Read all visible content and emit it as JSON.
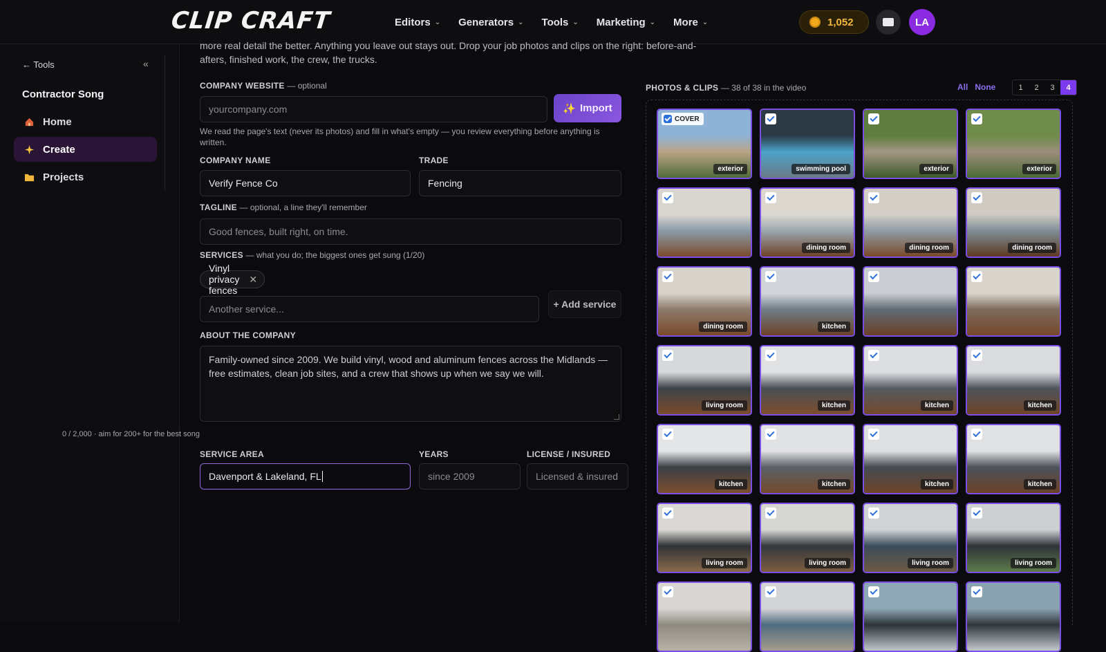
{
  "header": {
    "logo": "CLIP CRAFT",
    "nav": [
      {
        "label": "Editors"
      },
      {
        "label": "Generators"
      },
      {
        "label": "Tools"
      },
      {
        "label": "Marketing"
      },
      {
        "label": "More"
      }
    ],
    "coins": "1,052",
    "avatar_initials": "LA"
  },
  "sidebar": {
    "back_label": "← Tools",
    "collapse_label": "«",
    "title": "Contractor Song",
    "items": [
      {
        "label": "Home",
        "icon": "home-icon"
      },
      {
        "label": "Create",
        "icon": "sparkle-icon"
      },
      {
        "label": "Projects",
        "icon": "folder-icon"
      }
    ]
  },
  "form": {
    "intro": "more real detail the better. Anything you leave out stays out. Drop your job photos and clips on the right: before-and-afters, finished work, the crew, the trucks.",
    "website": {
      "label": "COMPANY WEBSITE",
      "optional": "— optional",
      "placeholder": "yourcompany.com",
      "import_label": "Import",
      "hint": "We read the page's text (never its photos) and fill in what's empty — you review everything before anything is written."
    },
    "company_name": {
      "label": "COMPANY NAME",
      "value": "Verify Fence Co"
    },
    "trade": {
      "label": "TRADE",
      "value": "Fencing"
    },
    "tagline": {
      "label": "TAGLINE",
      "optional": "— optional, a line they'll remember",
      "placeholder": "Good fences, built right, on time."
    },
    "services": {
      "label": "SERVICES",
      "optional": "— what you do; the biggest ones get sung (1/20)",
      "chips": [
        "Vinyl privacy fences"
      ],
      "placeholder": "Another service...",
      "add_label": "+ Add service"
    },
    "about": {
      "label": "ABOUT THE COMPANY",
      "value": "Family-owned since 2009. We build vinyl, wood and aluminum fences across the Midlands — free estimates, clean job sites, and a crew that shows up when we say we will.",
      "count": "0 / 2,000 · aim for 200+ for the best song"
    },
    "service_area": {
      "label": "SERVICE AREA",
      "value": "Davenport & Lakeland, FL"
    },
    "years": {
      "label": "YEARS",
      "placeholder": "since 2009"
    },
    "license": {
      "label": "LICENSE / INSURED",
      "placeholder": "Licensed & insured"
    }
  },
  "photos": {
    "title": "PHOTOS & CLIPS",
    "subtitle": "— 38 of 38 in the video",
    "all_label": "All",
    "none_label": "None",
    "pages": [
      "1",
      "2",
      "3",
      "4"
    ],
    "active_page": "4",
    "cover_label": "COVER",
    "items": [
      {
        "tag": "exterior",
        "cover": true,
        "palette": [
          "#8fb3d6",
          "#b9a486",
          "#4f6b3a"
        ]
      },
      {
        "tag": "swimming pool",
        "palette": [
          "#2c3a46",
          "#4aa3c8",
          "#6a7b86"
        ]
      },
      {
        "tag": "exterior",
        "palette": [
          "#5e7d3f",
          "#a39683",
          "#3d5a2a"
        ]
      },
      {
        "tag": "exterior",
        "palette": [
          "#6f8c4a",
          "#9c8e7c",
          "#4a6b34"
        ]
      },
      {
        "tag": "",
        "palette": [
          "#d9d6cf",
          "#8a9ba9",
          "#7a4b2c"
        ]
      },
      {
        "tag": "dining room",
        "palette": [
          "#dcd8d0",
          "#9aa6ae",
          "#6f4327"
        ]
      },
      {
        "tag": "dining room",
        "palette": [
          "#d3cec6",
          "#8f9ca4",
          "#7a4a2a"
        ]
      },
      {
        "tag": "dining room",
        "palette": [
          "#cfcac2",
          "#7f8d95",
          "#5e3a22"
        ]
      },
      {
        "tag": "dining room",
        "palette": [
          "#d7d2ca",
          "#8c7a6a",
          "#7b4a2b"
        ]
      },
      {
        "tag": "kitchen",
        "palette": [
          "#d2d6da",
          "#6f7c86",
          "#6d4327"
        ]
      },
      {
        "tag": "",
        "palette": [
          "#c9ccd0",
          "#5f6b74",
          "#6a4128"
        ]
      },
      {
        "tag": "",
        "palette": [
          "#d8d4cc",
          "#7c6a5c",
          "#76482a"
        ]
      },
      {
        "tag": "living room",
        "palette": [
          "#d6d9dc",
          "#3d4248",
          "#7a4c2c"
        ]
      },
      {
        "tag": "kitchen",
        "palette": [
          "#dfe1e3",
          "#4a4f55",
          "#7c4e2d"
        ]
      },
      {
        "tag": "kitchen",
        "palette": [
          "#dcdee1",
          "#555b62",
          "#74482a"
        ]
      },
      {
        "tag": "kitchen",
        "palette": [
          "#dadcdf",
          "#4e545b",
          "#6f4428"
        ]
      },
      {
        "tag": "kitchen",
        "palette": [
          "#e4e5e7",
          "#3b4046",
          "#7b4e2e"
        ]
      },
      {
        "tag": "kitchen",
        "palette": [
          "#e1e2e4",
          "#5a6067",
          "#75492b"
        ]
      },
      {
        "tag": "kitchen",
        "palette": [
          "#dedfe1",
          "#444a51",
          "#6e4429"
        ]
      },
      {
        "tag": "kitchen",
        "palette": [
          "#e0e1e3",
          "#4c5259",
          "#6b4228"
        ]
      },
      {
        "tag": "living room",
        "palette": [
          "#d9d8d4",
          "#2e3236",
          "#8a6a4a"
        ]
      },
      {
        "tag": "living room",
        "palette": [
          "#d6d6d3",
          "#34383d",
          "#7d5d40"
        ]
      },
      {
        "tag": "living room",
        "palette": [
          "#cfd3d6",
          "#3a4c5a",
          "#6e5a44"
        ]
      },
      {
        "tag": "living room",
        "palette": [
          "#ccd0d3",
          "#2f3338",
          "#5d7a4a"
        ]
      },
      {
        "tag": "",
        "palette": [
          "#d7d6d2",
          "#8f8a80",
          "#b7b2a6"
        ]
      },
      {
        "tag": "",
        "palette": [
          "#d3d4d6",
          "#4f6c7d",
          "#a59c8e"
        ]
      },
      {
        "tag": "",
        "palette": [
          "#8ea7b6",
          "#2d3338",
          "#bfc6cb"
        ]
      },
      {
        "tag": "",
        "palette": [
          "#8aa2b2",
          "#30363b",
          "#c3c8cc"
        ]
      }
    ]
  }
}
